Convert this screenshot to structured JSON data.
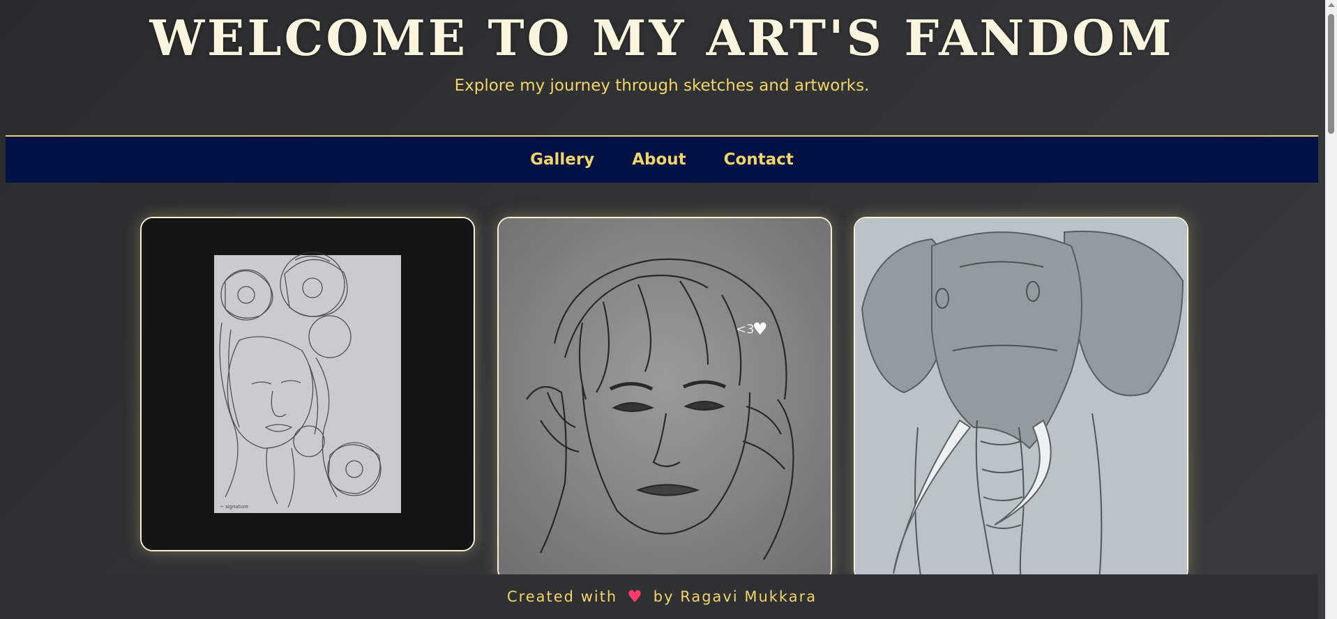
{
  "header": {
    "title": "WELCOME TO MY ART'S FANDOM",
    "tagline": "Explore my journey through sketches and artworks."
  },
  "nav": {
    "items": [
      {
        "label": "Gallery"
      },
      {
        "label": "About"
      },
      {
        "label": "Contact"
      }
    ]
  },
  "gallery": {
    "artworks": [
      {
        "subject": "woman-with-flowers-sketch"
      },
      {
        "subject": "boy-portrait-sketch",
        "caption": "<3"
      },
      {
        "subject": "elephant-sketch"
      }
    ]
  },
  "footer": {
    "prefix": "Created with",
    "heart_icon": "heart-icon",
    "suffix": "by Ragavi Mukkara"
  },
  "colors": {
    "title": "#fbf4de",
    "accent": "#f3d46a",
    "nav_bg": "#001144",
    "heart": "#ff3b6b"
  }
}
